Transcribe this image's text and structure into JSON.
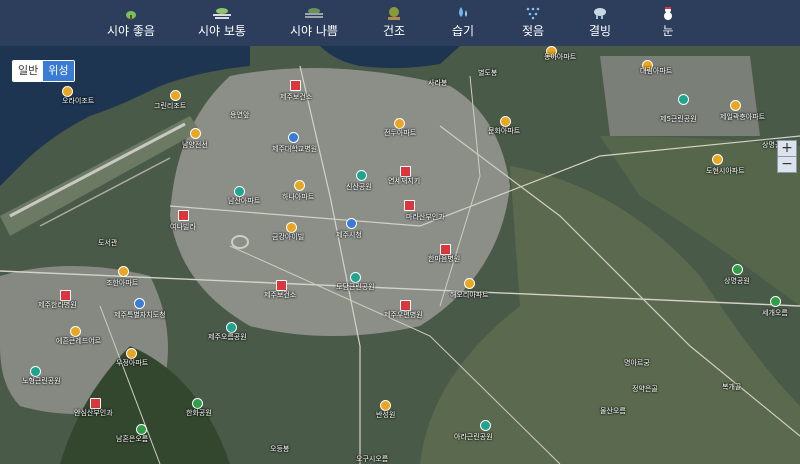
{
  "tabs": [
    {
      "label": "시야 좋음",
      "icon": "clear-sky-icon"
    },
    {
      "label": "시야 보통",
      "icon": "haze-icon"
    },
    {
      "label": "시야 나쁨",
      "icon": "fog-icon"
    },
    {
      "label": "건조",
      "icon": "dry-tree-icon"
    },
    {
      "label": "습기",
      "icon": "humidity-drop-icon"
    },
    {
      "label": "젖음",
      "icon": "wet-rain-icon"
    },
    {
      "label": "결빙",
      "icon": "ice-icon"
    },
    {
      "label": "눈",
      "icon": "snowman-icon"
    }
  ],
  "map_toggle": {
    "normal": "일반",
    "satellite": "위성",
    "active": "satellite"
  },
  "zoom": {
    "in": "+",
    "out": "−"
  },
  "places": [
    {
      "name": "사라봉",
      "kind": "none"
    },
    {
      "name": "별도봉",
      "kind": "none"
    },
    {
      "name": "동아아파트",
      "kind": "apartment"
    },
    {
      "name": "대림아파트",
      "kind": "apartment"
    },
    {
      "name": "오라이조트",
      "kind": "apartment"
    },
    {
      "name": "그린리조트",
      "kind": "apartment"
    },
    {
      "name": "제주보건소",
      "kind": "hospital"
    },
    {
      "name": "용연앞",
      "kind": "none"
    },
    {
      "name": "남양전선",
      "kind": "apartment"
    },
    {
      "name": "제주대학교병원",
      "kind": "school"
    },
    {
      "name": "전두아파트",
      "kind": "apartment"
    },
    {
      "name": "문화아파트",
      "kind": "apartment"
    },
    {
      "name": "제5근린공원",
      "kind": "park"
    },
    {
      "name": "제일곽충아파트",
      "kind": "apartment"
    },
    {
      "name": "신산공원",
      "kind": "park"
    },
    {
      "name": "하나아파트",
      "kind": "apartment"
    },
    {
      "name": "연세재지키",
      "kind": "hospital"
    },
    {
      "name": "도현시아파트",
      "kind": "apartment"
    },
    {
      "name": "남산아파트",
      "kind": "park"
    },
    {
      "name": "마라산부인과",
      "kind": "hospital"
    },
    {
      "name": "여나빌라",
      "kind": "hospital"
    },
    {
      "name": "제주시청",
      "kind": "school"
    },
    {
      "name": "도서관",
      "kind": "none"
    },
    {
      "name": "금강아이빌",
      "kind": "apartment"
    },
    {
      "name": "한마음병원",
      "kind": "hospital"
    },
    {
      "name": "조한아파트",
      "kind": "apartment"
    },
    {
      "name": "제주한라병원",
      "kind": "hospital"
    },
    {
      "name": "제주보건소",
      "kind": "hospital"
    },
    {
      "name": "도담근린공원",
      "kind": "park"
    },
    {
      "name": "해오리아파트",
      "kind": "apartment"
    },
    {
      "name": "제주특별자치도청",
      "kind": "school"
    },
    {
      "name": "제주우편병원",
      "kind": "hospital"
    },
    {
      "name": "에흔큰레드어르",
      "kind": "apartment"
    },
    {
      "name": "제주오름공원",
      "kind": "park"
    },
    {
      "name": "우정아파트",
      "kind": "apartment"
    },
    {
      "name": "노형근린공원",
      "kind": "park"
    },
    {
      "name": "명아르궁",
      "kind": "none"
    },
    {
      "name": "한화공원",
      "kind": "park"
    },
    {
      "name": "안심산부인과",
      "kind": "hospital"
    },
    {
      "name": "복개골",
      "kind": "none"
    },
    {
      "name": "반성원",
      "kind": "apartment"
    },
    {
      "name": "아라근린공원",
      "kind": "park"
    },
    {
      "name": "남혼은오름",
      "kind": "park"
    },
    {
      "name": "오등봉",
      "kind": "none"
    },
    {
      "name": "오구시오름",
      "kind": "none"
    },
    {
      "name": "상명공원",
      "kind": "park"
    },
    {
      "name": "세개오름",
      "kind": "park"
    },
    {
      "name": "상명공원",
      "kind": "park"
    },
    {
      "name": "정약은골",
      "kind": "none"
    },
    {
      "name": "물산오름",
      "kind": "none"
    }
  ]
}
